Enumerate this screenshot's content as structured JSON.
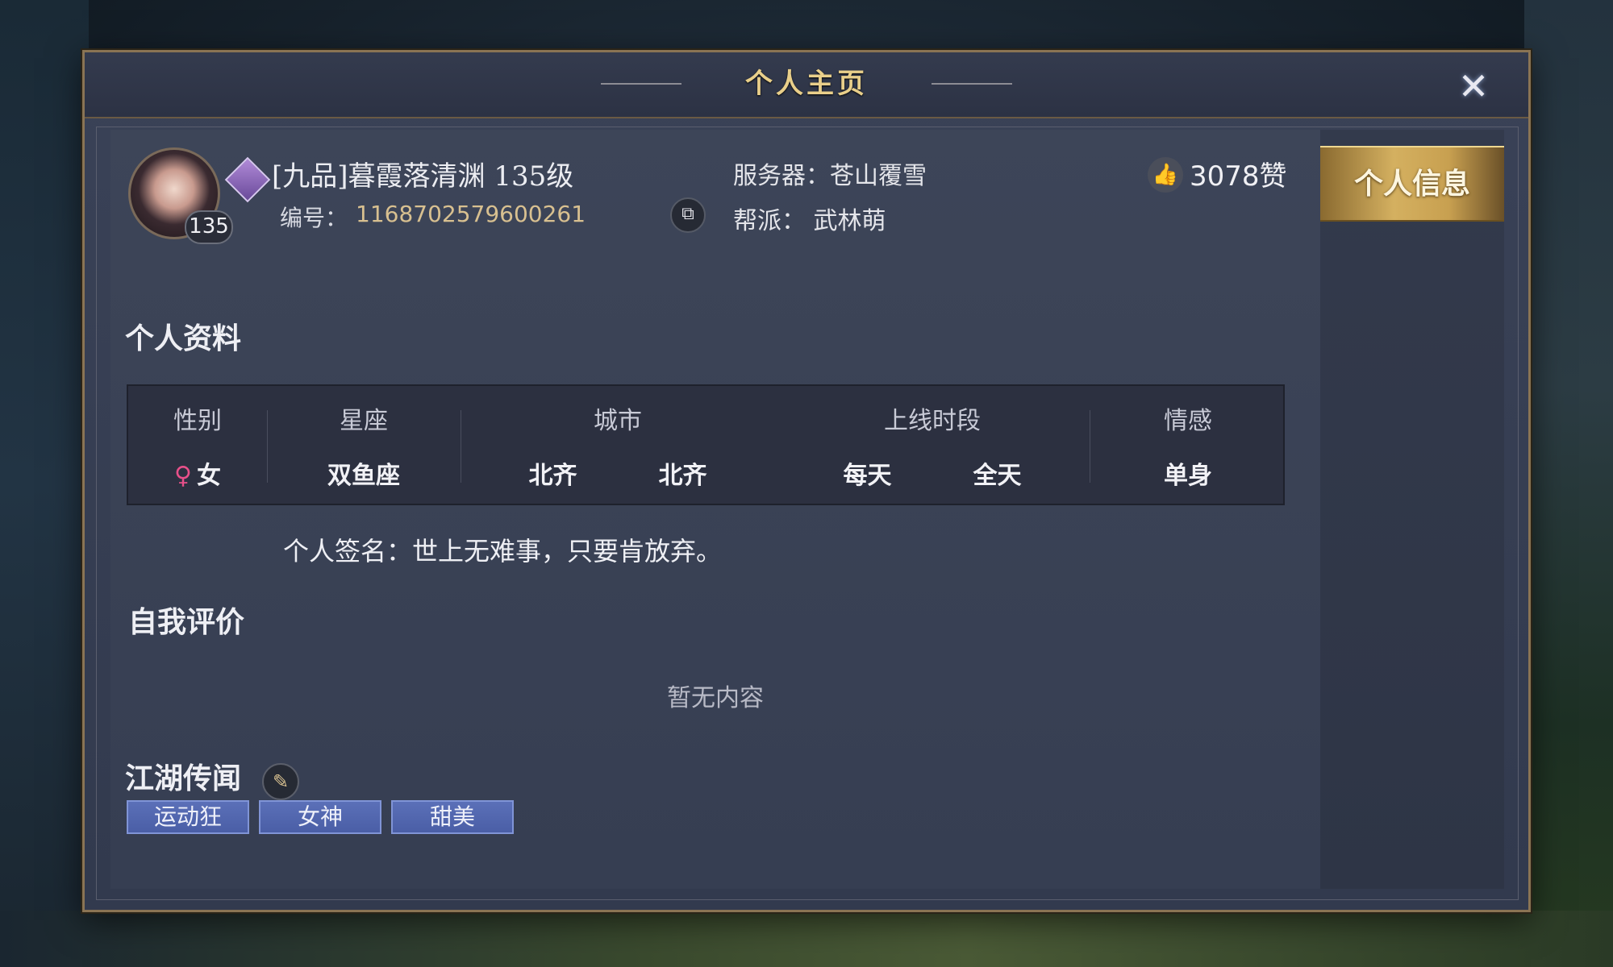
{
  "window": {
    "title": "个人主页"
  },
  "profile": {
    "avatar_level": "135",
    "name": "[九品]暮霞落清渊 135级",
    "id_label": "编号：",
    "id_value": "1168702579600261",
    "server": "服务器：苍山覆雪",
    "guild": "帮派：  武林萌",
    "likes": "3078赞"
  },
  "personal_info": {
    "section_title": "个人资料",
    "columns": [
      {
        "header": "性别",
        "values": [
          "女"
        ]
      },
      {
        "header": "星座",
        "values": [
          "双鱼座"
        ]
      },
      {
        "header": "城市",
        "values": [
          "北齐",
          "北齐"
        ]
      },
      {
        "header": "上线时段",
        "values": [
          "每天",
          "全天"
        ]
      },
      {
        "header": "情感",
        "values": [
          "单身"
        ]
      }
    ],
    "gender_icon": "♀",
    "signature": "个人签名：世上无难事，只要肯放弃。"
  },
  "self_eval": {
    "section_title": "自我评价",
    "empty_text": "暂无内容"
  },
  "rumors": {
    "section_title": "江湖传闻",
    "tags": [
      "运动狂",
      "女神",
      "甜美"
    ]
  },
  "sidebar": {
    "tabs": [
      {
        "label": "个人信息"
      }
    ]
  },
  "icons": {
    "close": "close-icon",
    "copy": "copy-icon",
    "like": "thumbs-up-icon",
    "edit": "brush-icon",
    "gender": "female-icon",
    "rank": "rank-badge-icon"
  },
  "colors": {
    "accent_gold": "#e9cf8a",
    "id_color": "#d8c090",
    "tag_blue": "#5b70b8",
    "female_pink": "#e8508a"
  }
}
